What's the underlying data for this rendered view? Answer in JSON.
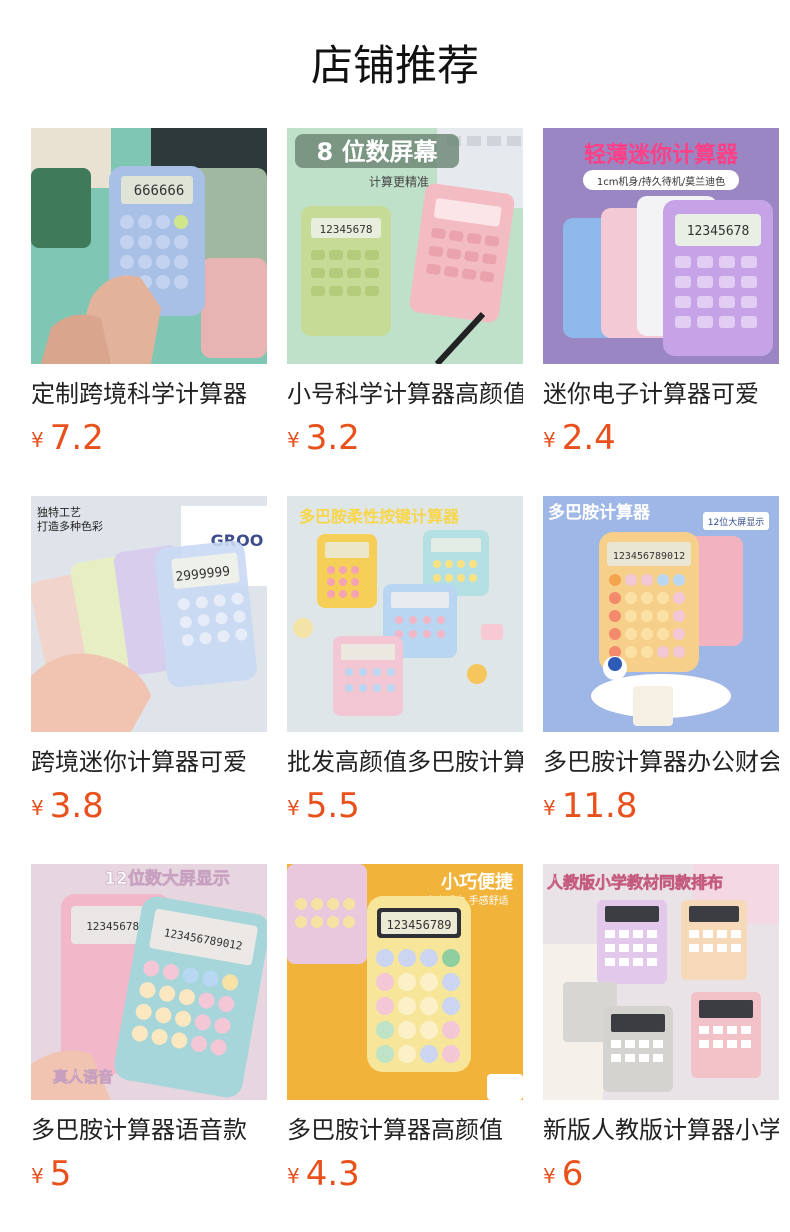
{
  "header": {
    "title": "店铺推荐"
  },
  "currency_symbol": "¥",
  "products": [
    {
      "title": "定制跨境科学计算器",
      "price": "7.2"
    },
    {
      "title": "小号科学计算器高颜值",
      "price": "3.2"
    },
    {
      "title": "迷你电子计算器可爱",
      "price": "2.4",
      "image_text": [
        "轻薄迷你计算器",
        "1cm机身/持久待机/莫兰迪色"
      ]
    },
    {
      "title": "跨境迷你计算器可爱",
      "price": "3.8",
      "image_text": [
        "独特工艺",
        "打造多种色彩"
      ]
    },
    {
      "title": "批发高颜值多巴胺计算器",
      "price": "5.5",
      "image_text": [
        "多巴胺柔性按键计算器"
      ]
    },
    {
      "title": "多巴胺计算器办公财会",
      "price": "11.8",
      "image_text": [
        "多巴胺计算器",
        "12位大屏显示"
      ]
    },
    {
      "title": "多巴胺计算器语音款",
      "price": "5",
      "image_text": [
        "12位数大屏显示",
        "真人语音"
      ]
    },
    {
      "title": "多巴胺计算器高颜值",
      "price": "4.3",
      "image_text": [
        "小巧便捷",
        "大小适中 手感舒适"
      ]
    },
    {
      "title": "新版人教版计算器小学",
      "price": "6",
      "image_text": [
        "人教版小学教材同款排布"
      ]
    }
  ],
  "image_text_extra": {
    "p2_badge": "8 位数屏幕",
    "p2_sub": "计算更精准"
  }
}
